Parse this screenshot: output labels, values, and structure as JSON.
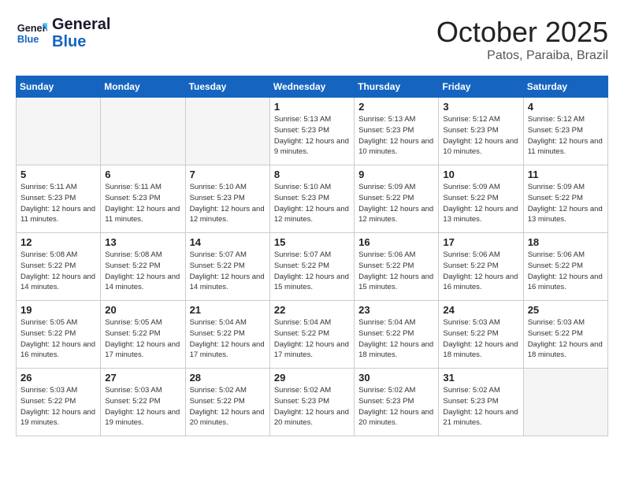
{
  "header": {
    "logo_line1": "General",
    "logo_line2": "Blue",
    "month": "October 2025",
    "location": "Patos, Paraiba, Brazil"
  },
  "weekdays": [
    "Sunday",
    "Monday",
    "Tuesday",
    "Wednesday",
    "Thursday",
    "Friday",
    "Saturday"
  ],
  "weeks": [
    [
      {
        "num": "",
        "info": ""
      },
      {
        "num": "",
        "info": ""
      },
      {
        "num": "",
        "info": ""
      },
      {
        "num": "1",
        "info": "Sunrise: 5:13 AM\nSunset: 5:23 PM\nDaylight: 12 hours\nand 9 minutes."
      },
      {
        "num": "2",
        "info": "Sunrise: 5:13 AM\nSunset: 5:23 PM\nDaylight: 12 hours\nand 10 minutes."
      },
      {
        "num": "3",
        "info": "Sunrise: 5:12 AM\nSunset: 5:23 PM\nDaylight: 12 hours\nand 10 minutes."
      },
      {
        "num": "4",
        "info": "Sunrise: 5:12 AM\nSunset: 5:23 PM\nDaylight: 12 hours\nand 11 minutes."
      }
    ],
    [
      {
        "num": "5",
        "info": "Sunrise: 5:11 AM\nSunset: 5:23 PM\nDaylight: 12 hours\nand 11 minutes."
      },
      {
        "num": "6",
        "info": "Sunrise: 5:11 AM\nSunset: 5:23 PM\nDaylight: 12 hours\nand 11 minutes."
      },
      {
        "num": "7",
        "info": "Sunrise: 5:10 AM\nSunset: 5:23 PM\nDaylight: 12 hours\nand 12 minutes."
      },
      {
        "num": "8",
        "info": "Sunrise: 5:10 AM\nSunset: 5:23 PM\nDaylight: 12 hours\nand 12 minutes."
      },
      {
        "num": "9",
        "info": "Sunrise: 5:09 AM\nSunset: 5:22 PM\nDaylight: 12 hours\nand 12 minutes."
      },
      {
        "num": "10",
        "info": "Sunrise: 5:09 AM\nSunset: 5:22 PM\nDaylight: 12 hours\nand 13 minutes."
      },
      {
        "num": "11",
        "info": "Sunrise: 5:09 AM\nSunset: 5:22 PM\nDaylight: 12 hours\nand 13 minutes."
      }
    ],
    [
      {
        "num": "12",
        "info": "Sunrise: 5:08 AM\nSunset: 5:22 PM\nDaylight: 12 hours\nand 14 minutes."
      },
      {
        "num": "13",
        "info": "Sunrise: 5:08 AM\nSunset: 5:22 PM\nDaylight: 12 hours\nand 14 minutes."
      },
      {
        "num": "14",
        "info": "Sunrise: 5:07 AM\nSunset: 5:22 PM\nDaylight: 12 hours\nand 14 minutes."
      },
      {
        "num": "15",
        "info": "Sunrise: 5:07 AM\nSunset: 5:22 PM\nDaylight: 12 hours\nand 15 minutes."
      },
      {
        "num": "16",
        "info": "Sunrise: 5:06 AM\nSunset: 5:22 PM\nDaylight: 12 hours\nand 15 minutes."
      },
      {
        "num": "17",
        "info": "Sunrise: 5:06 AM\nSunset: 5:22 PM\nDaylight: 12 hours\nand 16 minutes."
      },
      {
        "num": "18",
        "info": "Sunrise: 5:06 AM\nSunset: 5:22 PM\nDaylight: 12 hours\nand 16 minutes."
      }
    ],
    [
      {
        "num": "19",
        "info": "Sunrise: 5:05 AM\nSunset: 5:22 PM\nDaylight: 12 hours\nand 16 minutes."
      },
      {
        "num": "20",
        "info": "Sunrise: 5:05 AM\nSunset: 5:22 PM\nDaylight: 12 hours\nand 17 minutes."
      },
      {
        "num": "21",
        "info": "Sunrise: 5:04 AM\nSunset: 5:22 PM\nDaylight: 12 hours\nand 17 minutes."
      },
      {
        "num": "22",
        "info": "Sunrise: 5:04 AM\nSunset: 5:22 PM\nDaylight: 12 hours\nand 17 minutes."
      },
      {
        "num": "23",
        "info": "Sunrise: 5:04 AM\nSunset: 5:22 PM\nDaylight: 12 hours\nand 18 minutes."
      },
      {
        "num": "24",
        "info": "Sunrise: 5:03 AM\nSunset: 5:22 PM\nDaylight: 12 hours\nand 18 minutes."
      },
      {
        "num": "25",
        "info": "Sunrise: 5:03 AM\nSunset: 5:22 PM\nDaylight: 12 hours\nand 18 minutes."
      }
    ],
    [
      {
        "num": "26",
        "info": "Sunrise: 5:03 AM\nSunset: 5:22 PM\nDaylight: 12 hours\nand 19 minutes."
      },
      {
        "num": "27",
        "info": "Sunrise: 5:03 AM\nSunset: 5:22 PM\nDaylight: 12 hours\nand 19 minutes."
      },
      {
        "num": "28",
        "info": "Sunrise: 5:02 AM\nSunset: 5:22 PM\nDaylight: 12 hours\nand 20 minutes."
      },
      {
        "num": "29",
        "info": "Sunrise: 5:02 AM\nSunset: 5:23 PM\nDaylight: 12 hours\nand 20 minutes."
      },
      {
        "num": "30",
        "info": "Sunrise: 5:02 AM\nSunset: 5:23 PM\nDaylight: 12 hours\nand 20 minutes."
      },
      {
        "num": "31",
        "info": "Sunrise: 5:02 AM\nSunset: 5:23 PM\nDaylight: 12 hours\nand 21 minutes."
      },
      {
        "num": "",
        "info": ""
      }
    ]
  ]
}
